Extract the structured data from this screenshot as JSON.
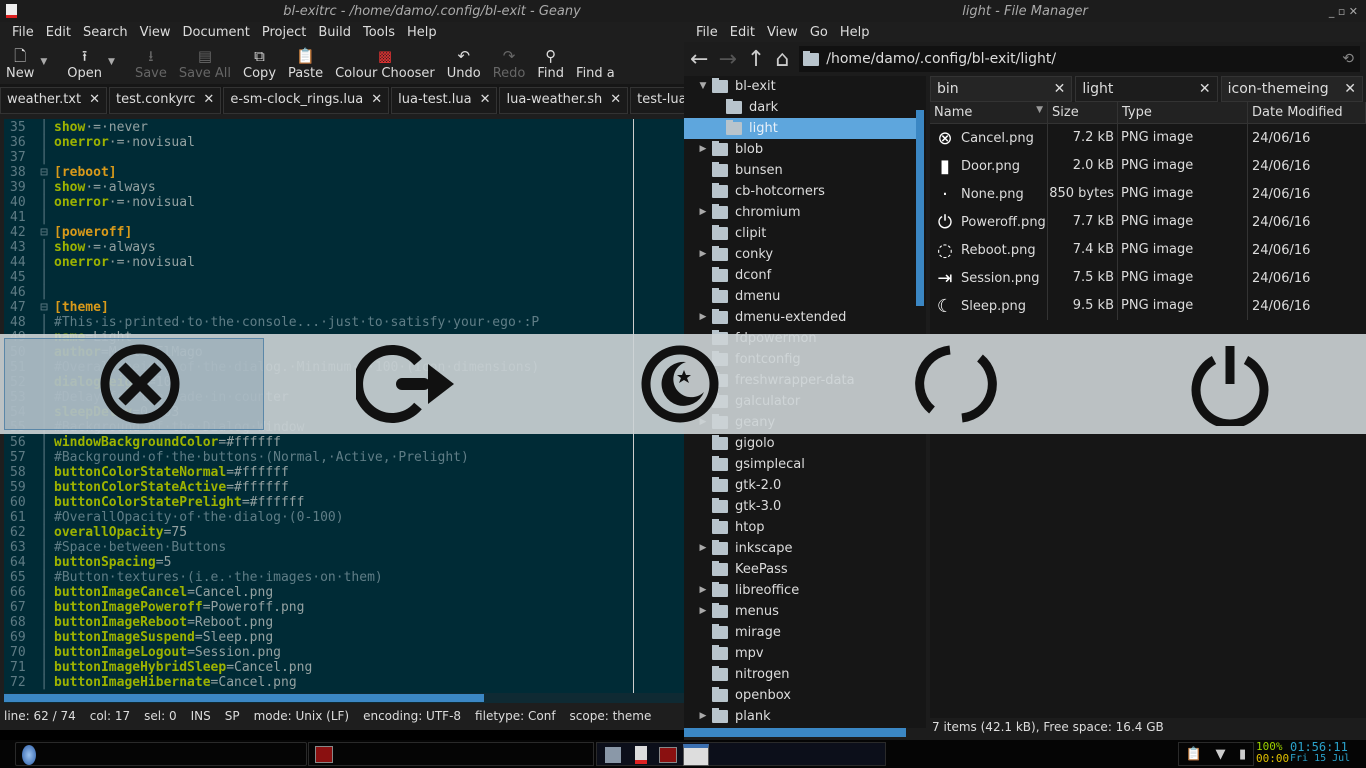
{
  "geany": {
    "title": "bl-exitrc - /home/damo/.config/bl-exit - Geany",
    "menu": [
      "File",
      "Edit",
      "Search",
      "View",
      "Document",
      "Project",
      "Build",
      "Tools",
      "Help"
    ],
    "toolbar": [
      {
        "label": "New",
        "icon": "new-file-icon",
        "dis": false
      },
      {
        "label": "Open",
        "icon": "open-icon",
        "dis": false
      },
      {
        "label": "Save",
        "icon": "save-icon",
        "dis": true
      },
      {
        "label": "Save All",
        "icon": "save-all-icon",
        "dis": true
      },
      {
        "label": "Copy",
        "icon": "copy-icon",
        "dis": false
      },
      {
        "label": "Paste",
        "icon": "paste-icon",
        "dis": false
      },
      {
        "label": "Colour Chooser",
        "icon": "colour-chooser-icon",
        "dis": false
      },
      {
        "label": "Undo",
        "icon": "undo-icon",
        "dis": false
      },
      {
        "label": "Redo",
        "icon": "redo-icon",
        "dis": true
      },
      {
        "label": "Find",
        "icon": "find-icon",
        "dis": false
      },
      {
        "label": "Find a",
        "icon": "",
        "dis": false
      }
    ],
    "tabs": [
      "weather.txt",
      "test.conkyrc",
      "e-sm-clock_rings.lua",
      "lua-test.lua",
      "lua-weather.sh",
      "test-lua.lua"
    ],
    "lines": [
      {
        "n": "35",
        "t": "kv",
        "k": "show",
        "v": "·=·never"
      },
      {
        "n": "36",
        "t": "kv",
        "k": "onerror",
        "v": "·=·novisual"
      },
      {
        "n": "37",
        "t": "blank"
      },
      {
        "n": "38",
        "t": "sec",
        "k": "[reboot]"
      },
      {
        "n": "39",
        "t": "kv",
        "k": "show",
        "v": "·=·always"
      },
      {
        "n": "40",
        "t": "kv",
        "k": "onerror",
        "v": "·=·novisual"
      },
      {
        "n": "41",
        "t": "blank"
      },
      {
        "n": "42",
        "t": "sec",
        "k": "[poweroff]"
      },
      {
        "n": "43",
        "t": "kv",
        "k": "show",
        "v": "·=·always"
      },
      {
        "n": "44",
        "t": "kv",
        "k": "onerror",
        "v": "·=·novisual"
      },
      {
        "n": "45",
        "t": "blank"
      },
      {
        "n": "46",
        "t": "blank"
      },
      {
        "n": "47",
        "t": "sec",
        "k": "[theme]"
      },
      {
        "n": "48",
        "t": "com",
        "k": "#This·is·printed·to·the·console...·just·to·satisfy·your·ego·:P"
      },
      {
        "n": "49",
        "t": "kv",
        "k": "name",
        "v": "=Light"
      },
      {
        "n": "50",
        "t": "kv",
        "k": "author",
        "v": "=MerlinElMago"
      },
      {
        "n": "51",
        "t": "com",
        "k": "#Overall·height·of·the·dialog.·Minimum·=·100·(icon·dimensions)"
      },
      {
        "n": "52",
        "t": "kv",
        "k": "dialogHeight",
        "v": "=100"
      },
      {
        "n": "53",
        "t": "com",
        "k": "#Delay·for·the·fade·in·counter"
      },
      {
        "n": "54",
        "t": "kv",
        "k": "sleepDelay",
        "v": "=0.003"
      },
      {
        "n": "55",
        "t": "com",
        "k": "#Background·of·the·Dialog·Window"
      },
      {
        "n": "56",
        "t": "kv",
        "k": "windowBackgroundColor",
        "v": "=#ffffff"
      },
      {
        "n": "57",
        "t": "com",
        "k": "#Background·of·the·buttons·(Normal,·Active,·Prelight)"
      },
      {
        "n": "58",
        "t": "kv",
        "k": "buttonColorStateNormal",
        "v": "=#ffffff"
      },
      {
        "n": "59",
        "t": "kv",
        "k": "buttonColorStateActive",
        "v": "=#ffffff"
      },
      {
        "n": "60",
        "t": "kv",
        "k": "buttonColorStatePrelight",
        "v": "=#ffffff"
      },
      {
        "n": "61",
        "t": "com",
        "k": "#OverallOpacity·of·the·dialog·(0-100)"
      },
      {
        "n": "62",
        "t": "kv",
        "k": "overallOpacity",
        "v": "=75"
      },
      {
        "n": "63",
        "t": "com",
        "k": "#Space·between·Buttons"
      },
      {
        "n": "64",
        "t": "kv",
        "k": "buttonSpacing",
        "v": "=5"
      },
      {
        "n": "65",
        "t": "com",
        "k": "#Button·textures·(i.e.·the·images·on·them)"
      },
      {
        "n": "66",
        "t": "kv",
        "k": "buttonImageCancel",
        "v": "=Cancel.png"
      },
      {
        "n": "67",
        "t": "kv",
        "k": "buttonImagePoweroff",
        "v": "=Poweroff.png"
      },
      {
        "n": "68",
        "t": "kv",
        "k": "buttonImageReboot",
        "v": "=Reboot.png"
      },
      {
        "n": "69",
        "t": "kv",
        "k": "buttonImageSuspend",
        "v": "=Sleep.png"
      },
      {
        "n": "70",
        "t": "kv",
        "k": "buttonImageLogout",
        "v": "=Session.png"
      },
      {
        "n": "71",
        "t": "kv",
        "k": "buttonImageHybridSleep",
        "v": "=Cancel.png"
      },
      {
        "n": "72",
        "t": "kv",
        "k": "buttonImageHibernate",
        "v": "=Cancel.png"
      }
    ],
    "status": [
      "line: 62 / 74",
      "col: 17",
      "sel: 0",
      "INS",
      "SP",
      "mode: Unix (LF)",
      "encoding: UTF-8",
      "filetype: Conf",
      "scope: theme"
    ]
  },
  "fm": {
    "title": "light - File Manager",
    "menu": [
      "File",
      "Edit",
      "View",
      "Go",
      "Help"
    ],
    "path": "/home/damo/.config/bl-exit/light/",
    "tree": [
      {
        "name": "bl-exit",
        "lvl": 1,
        "exp": "open"
      },
      {
        "name": "dark",
        "lvl": 2
      },
      {
        "name": "light",
        "lvl": 2,
        "sel": true
      },
      {
        "name": "blob",
        "lvl": 1,
        "exp": "closed"
      },
      {
        "name": "bunsen",
        "lvl": 1
      },
      {
        "name": "cb-hotcorners",
        "lvl": 1
      },
      {
        "name": "chromium",
        "lvl": 1,
        "exp": "closed"
      },
      {
        "name": "clipit",
        "lvl": 1
      },
      {
        "name": "conky",
        "lvl": 1,
        "exp": "closed"
      },
      {
        "name": "dconf",
        "lvl": 1
      },
      {
        "name": "dmenu",
        "lvl": 1
      },
      {
        "name": "dmenu-extended",
        "lvl": 1,
        "exp": "closed"
      },
      {
        "name": "fdpowermon",
        "lvl": 1
      },
      {
        "name": "fontconfig",
        "lvl": 1
      },
      {
        "name": "freshwrapper-data",
        "lvl": 1
      },
      {
        "name": "galculator",
        "lvl": 1
      },
      {
        "name": "geany",
        "lvl": 1,
        "exp": "closed"
      },
      {
        "name": "gigolo",
        "lvl": 1
      },
      {
        "name": "gsimplecal",
        "lvl": 1
      },
      {
        "name": "gtk-2.0",
        "lvl": 1
      },
      {
        "name": "gtk-3.0",
        "lvl": 1
      },
      {
        "name": "htop",
        "lvl": 1
      },
      {
        "name": "inkscape",
        "lvl": 1,
        "exp": "closed"
      },
      {
        "name": "KeePass",
        "lvl": 1
      },
      {
        "name": "libreoffice",
        "lvl": 1,
        "exp": "closed"
      },
      {
        "name": "menus",
        "lvl": 1,
        "exp": "closed"
      },
      {
        "name": "mirage",
        "lvl": 1
      },
      {
        "name": "mpv",
        "lvl": 1
      },
      {
        "name": "nitrogen",
        "lvl": 1
      },
      {
        "name": "openbox",
        "lvl": 1
      },
      {
        "name": "plank",
        "lvl": 1,
        "exp": "closed"
      }
    ],
    "tabs": [
      "bin",
      "light",
      "icon-themeing"
    ],
    "columns": [
      "Name",
      "Size",
      "Type",
      "Date Modified"
    ],
    "files": [
      {
        "name": "Cancel.png",
        "size": "7.2 kB",
        "type": "PNG image",
        "date": "24/06/16",
        "icon": "⊗"
      },
      {
        "name": "Door.png",
        "size": "2.0 kB",
        "type": "PNG image",
        "date": "24/06/16",
        "icon": "▮"
      },
      {
        "name": "None.png",
        "size": "850 bytes",
        "type": "PNG image",
        "date": "24/06/16",
        "icon": "·"
      },
      {
        "name": "Poweroff.png",
        "size": "7.7 kB",
        "type": "PNG image",
        "date": "24/06/16",
        "icon": "⏻"
      },
      {
        "name": "Reboot.png",
        "size": "7.4 kB",
        "type": "PNG image",
        "date": "24/06/16",
        "icon": "◌"
      },
      {
        "name": "Session.png",
        "size": "7.5 kB",
        "type": "PNG image",
        "date": "24/06/16",
        "icon": "⇥"
      },
      {
        "name": "Sleep.png",
        "size": "9.5 kB",
        "type": "PNG image",
        "date": "24/06/16",
        "icon": "☾"
      }
    ],
    "status": "7 items (42.1 kB), Free space: 16.4 GB"
  },
  "exit_dialog": {
    "buttons": [
      "cancel",
      "logout",
      "suspend",
      "reboot",
      "poweroff"
    ]
  },
  "tray": {
    "battery": "100%",
    "time_left": "00:00",
    "clock": "01:56:11",
    "date": "Fri 15 Jul"
  }
}
